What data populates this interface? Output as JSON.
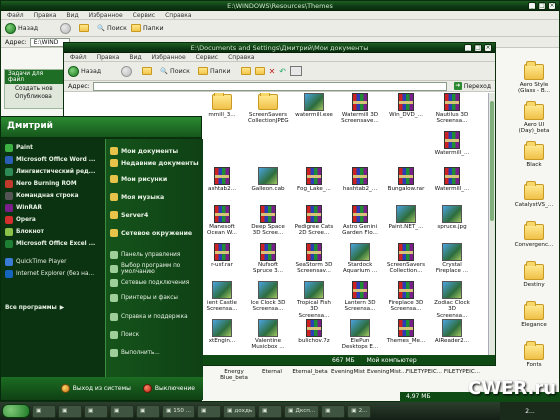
{
  "back_window": {
    "title": "E:\\WINDOWS\\Resources\\Themes",
    "menu": [
      "Файл",
      "Правка",
      "Вид",
      "Избранное",
      "Сервис",
      "Справка"
    ],
    "back_label": "Назад",
    "search_label": "Поиск",
    "folders_label": "Папки",
    "address_label": "Адрес:",
    "address_value": "E:\\WIND",
    "tasks_header": "Задачи для файл",
    "task1": "Создать нов",
    "task2": "Опубликова"
  },
  "front_window": {
    "title": "E:\\Documents and Settings\\Дмитрий\\Мои документы",
    "menu": [
      "Файл",
      "Правка",
      "Вид",
      "Избранное",
      "Сервис",
      "Справка"
    ],
    "back_label": "Назад",
    "search_label": "Поиск",
    "folders_label": "Папки",
    "address_label": "Адрес:",
    "go_label": "Переход",
    "status_size": "667 МБ",
    "status_location": "Мой компьютер"
  },
  "files": [
    [
      "mmill_3...",
      "ScreenSavers CollectionJPEG",
      "watermill.exe",
      "Watermill 3D Screensave...",
      "Win_DVD_...",
      "Nautilus 3D Screensa..."
    ],
    [
      "",
      "",
      "",
      "",
      "",
      "Watermill_..."
    ],
    [
      "ashtab2...",
      "Galleon.cab",
      "Fog_Lake_...",
      "hashtab2_...",
      "Bungalow.rar",
      "Watermill_..."
    ],
    [
      "Manesoft Ocean W...",
      "Deep Space 3D Scree...",
      "Pedigree Cats 2D Scree...",
      "Astro Genini Garden Flo...",
      "Paint.NET_...",
      "spruce.jpg"
    ],
    [
      "r-usf.rar",
      "Nufsoft Spruce 3...",
      "SeaStorm 3D Screensav...",
      "Stardock Aquarium ...",
      "ScreenSavers Collection...",
      "Crystal Fireplace ..."
    ],
    [
      "ient Castle Screensa...",
      "Ice Clock 3D Screensa...",
      "Tropical Fish 3D Screensa...",
      "Lantern 3D Screensa...",
      "Fireplace 3D Screensa...",
      "Zodiac Clock 3D Screensa..."
    ],
    [
      "xtEngin...",
      "Valentine Musicbox ...",
      "bulichov.7z",
      "ElePun Desktops E...",
      "Themes_Me...",
      "AIReader2..."
    ]
  ],
  "back_files": [
    "Energy Blue_beta",
    "Eternal",
    "Eternal_beta",
    "EveningMist",
    "EveningMist...",
    "FILETYPEIC...",
    "FILETYPEIC..."
  ],
  "right_files": [
    "Aero Style (Glass - B...",
    "Aero UI (Day)_beta",
    "Black",
    "CatalystVS_...",
    "Convergenc...",
    "Destiny",
    "Elegance",
    "Fonts"
  ],
  "start_menu": {
    "user": "Дмитрий",
    "left": [
      "Paint",
      "Microsoft Office Word ...",
      "Лингвистический ред...",
      "Nero Burning ROM",
      "Командная строка",
      "WinRAR",
      "Opera",
      "Блокнот",
      "Microsoft Office Excel ...",
      "QuickTime Player",
      "Internet Explorer (без на..."
    ],
    "all_programs": "Все программы",
    "right": [
      "Мои документы",
      "Недавние документы",
      "Мои рисунки",
      "Моя музыка",
      "Server4",
      "Сетевое окружение",
      "Панель управления",
      "Выбор программ по умолчанию",
      "Сетевые подключения",
      "Принтеры и факсы",
      "Справка и поддержка",
      "Поиск",
      "Выполнить..."
    ],
    "logoff": "Выход из системы",
    "shutdown": "Выключение"
  },
  "status_bar_size": "4,97 МБ",
  "taskbar": [
    "",
    "",
    "",
    "",
    "",
    "150 ...",
    "",
    "дохдь",
    "",
    "Дксп...",
    "",
    "2..."
  ],
  "watermark": "CWER.ru"
}
